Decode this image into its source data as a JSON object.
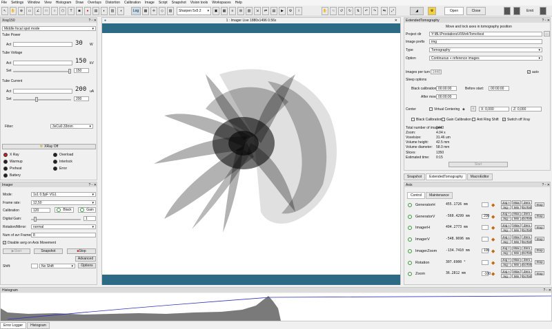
{
  "menubar": [
    "File",
    "Settings",
    "Window",
    "View",
    "Histogram",
    "Draw",
    "Overlays",
    "Distortion",
    "Calibration",
    "Image",
    "Script",
    "Snapshot",
    "Vision tools",
    "Workspaces",
    "Help"
  ],
  "toolbar": {
    "log_label": "Log",
    "sharpen_label": "Sharpen 5x5 2",
    "open_label": "Open",
    "close_label": "Close",
    "emit_label": "Emit"
  },
  "xray": {
    "title": "Xray150",
    "focal_mode": "Middle focal spot mode",
    "tube_power_label": "Tube Power",
    "act_label": "Act",
    "power_value": "30",
    "power_unit": "W",
    "tube_voltage_label": "Tube Voltage",
    "voltage_value": "150",
    "voltage_unit": "kV",
    "set_label": "Set",
    "voltage_set": "150",
    "tube_current_label": "Tube Current",
    "current_value": "200",
    "current_unit": "uA",
    "current_set": "200",
    "filter_label": "Filter:",
    "filter_value": "3xCu0.33mm",
    "xray_off_label": "XRay Off",
    "status": [
      [
        "X Ray",
        "Overload"
      ],
      [
        "Warmup",
        "Interlock"
      ],
      [
        "Preheat",
        "Error"
      ],
      [
        "Battery",
        ""
      ]
    ]
  },
  "imager": {
    "title": "Imager",
    "mode_label": "Mode:",
    "mode_value": "1x1 0.5pF VG1",
    "frame_label": "Frame rate:",
    "frame_value": "12,50",
    "calib_label": "Calibration",
    "calib_value": "120",
    "black_label": "Black",
    "gain_label": "Gain",
    "digital_label": "Digital Gain:",
    "digital_value": "1",
    "rot_label": "Rotation/Mirror:",
    "rot_value": "normal",
    "avr_label": "Num of avr Frames:",
    "avr_value": "8",
    "disable_label": "Disable avrg on Axis Movement",
    "start_label": "Start",
    "snapshot_label": "Snapshot",
    "stop_label": "Stop",
    "advanced_label": "Advanced",
    "shift_label": "Shift:",
    "shift_value": "No Shift",
    "options_label": "Options"
  },
  "viewer": {
    "title": "1 : Imager Live   1880x1496  0.56x"
  },
  "ext": {
    "title": "ExtendedTomography",
    "subtitle": "Move and lock axes in tomography position",
    "dir_label": "Project dir",
    "dir_value": "Y:\\BL\\Prostations\\XWorkTomo\\test",
    "prefix_label": "Image prefix",
    "prefix_value": "img",
    "type_label": "Type",
    "type_value": "Tomography",
    "option_label": "Option",
    "option_value": "Continuous + reference images",
    "turn_label": "Images per turn",
    "turn_value": "1440",
    "auto_label": "auto",
    "sleep_label": "Sleep options",
    "bc_label": "Black calibration:",
    "bc_value": "00:00:00",
    "bs_label": "Before start:",
    "bs_value": "00:00:00",
    "am_label": "After move:",
    "am_value": "00:00:00",
    "center_label": "Center",
    "vc_label": "Virtual Centering",
    "x_label": "X: 0,000",
    "z_label": "Z: 0,000",
    "cb_black": "Black Calibration",
    "cb_gain": "Gain Calibration",
    "cb_ring": "Anti Ring Shift",
    "cb_switch": "Switch off Xray",
    "stats": [
      [
        "Total number of images:",
        "1440"
      ],
      [
        "Zoom:",
        "4.04 x"
      ],
      [
        "Voxelsize:",
        "31.46 um"
      ],
      [
        "Volume height:",
        "42.5 mm"
      ],
      [
        "Volume diameter:",
        "58.0 mm"
      ],
      [
        "Slices:",
        "1350"
      ],
      [
        "Estimated time:",
        "0:15"
      ]
    ],
    "start_label": "Start"
  },
  "tabs": [
    "Snapshot",
    "ExtendedTomography",
    "MacroEditor"
  ],
  "axis": {
    "title": "Axis",
    "tabs": [
      "Control",
      "Maintenance"
    ],
    "rows": [
      {
        "name": "GeneratorH",
        "value": "455.1726 mm",
        "step": ""
      },
      {
        "name": "GeneratorV",
        "value": "-560.4299 mm",
        "step": "200"
      },
      {
        "name": "ImagerH",
        "value": "494.2773 mm",
        "step": ""
      },
      {
        "name": "ImagerV",
        "value": "-548.9696 mm",
        "step": ""
      },
      {
        "name": "ImagerZoom",
        "value": "-134.7410 mm",
        "step": "100"
      },
      {
        "name": "Rotation",
        "value": "307.6900 °",
        "step": ""
      },
      {
        "name": "Zoom",
        "value": "36.2812 mm",
        "step": "-100"
      }
    ],
    "jogp": "Jog +",
    "jogm": "Jog -",
    "max": "Max",
    "min": "Min",
    "zero": "Zero",
    "goto": "GoTo0",
    "stop": "Stop"
  },
  "histogram": {
    "title": "Histogram"
  },
  "bottom_tabs": [
    "Error Logger",
    "Histogram"
  ],
  "colors": {
    "accent": "#2c6a86",
    "green": "#3a9a3a",
    "red": "#c42020"
  }
}
